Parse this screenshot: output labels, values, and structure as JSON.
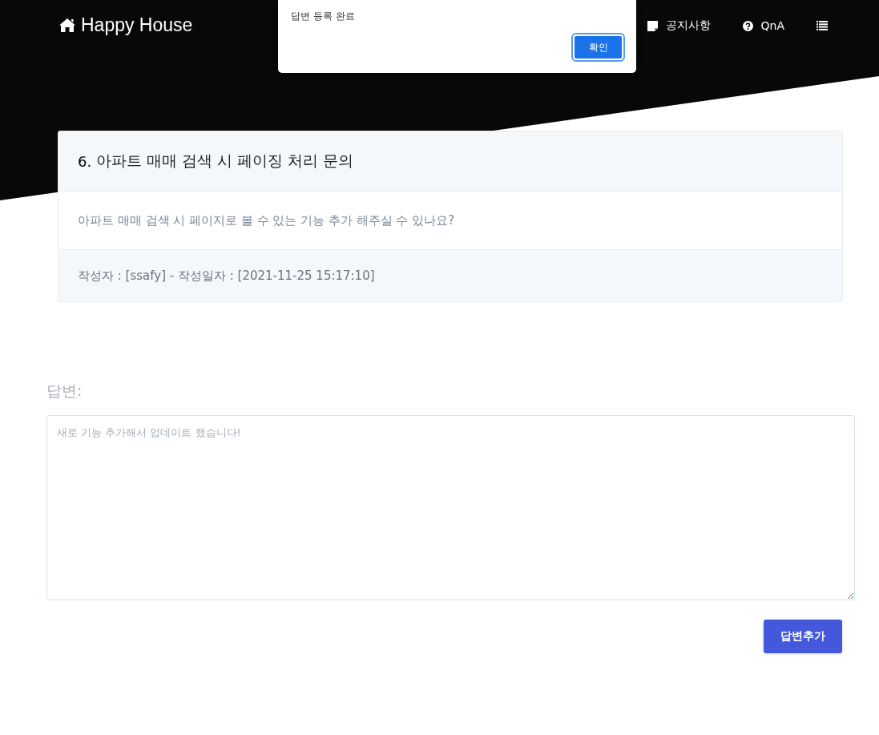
{
  "navbar": {
    "brand": "Happy House",
    "items": [
      {
        "kind": "notice",
        "label": "공지사항"
      },
      {
        "kind": "qna",
        "label": "QnA"
      },
      {
        "kind": "menu"
      }
    ]
  },
  "alert": {
    "message": "답변 등록 완료",
    "button": "확인"
  },
  "question": {
    "number": "6.",
    "title": "아파트 매매 검색 시 페이징 처리 문의",
    "content": "아파트 매매 검색 시 페이지로 볼 수 있는 기능 추가 해주실 수 있나요?",
    "meta": "작성자 : [ssafy] - 작성일자 : [2021-11-25 15:17:10]"
  },
  "answer": {
    "label": "답변:",
    "placeholder": "새로 기능 추가해서 업데이트 했습니다!",
    "button": "답변추가"
  }
}
